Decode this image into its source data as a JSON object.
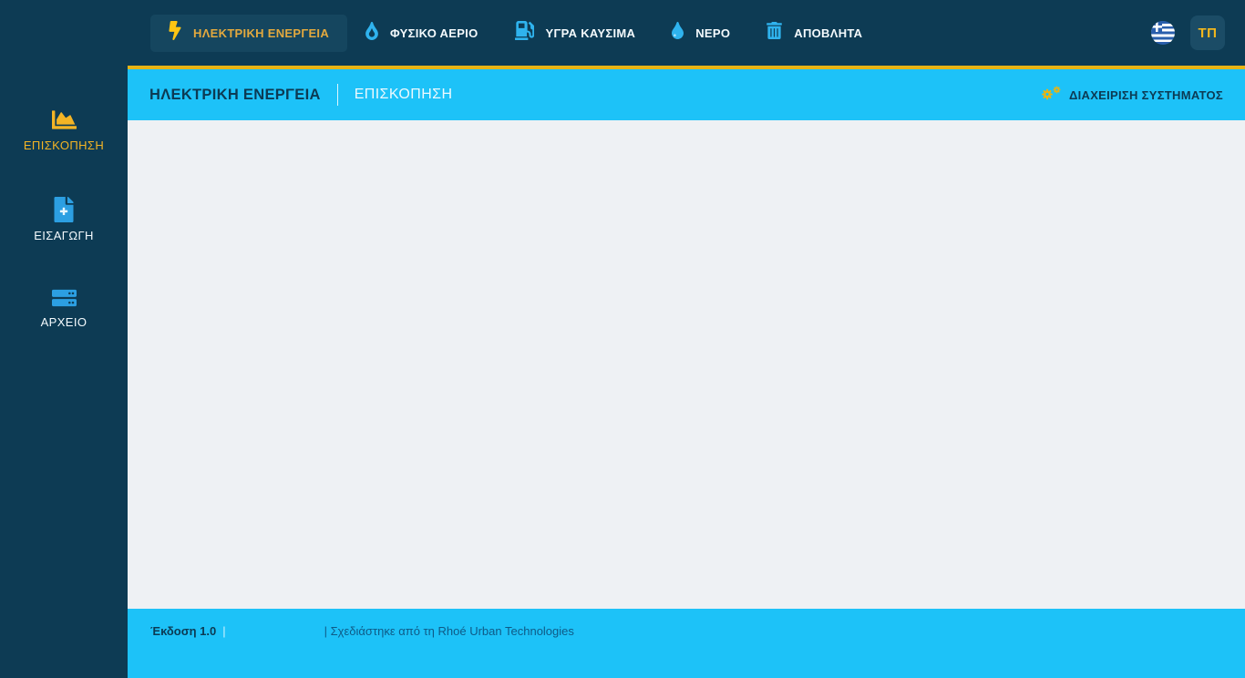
{
  "topnav": {
    "tabs": [
      {
        "label": "ΗΛΕΚΤΡΙΚΗ ΕΝΕΡΓΕΙΑ",
        "icon": "lightning-bolt-icon",
        "active": true
      },
      {
        "label": "ΦΥΣΙΚΟ ΑΕΡΙΟ",
        "icon": "gas-drop-icon",
        "active": false
      },
      {
        "label": "ΥΓΡΑ ΚΑΥΣΙΜΑ",
        "icon": "fuel-pump-icon",
        "active": false
      },
      {
        "label": "ΝΕΡΟ",
        "icon": "water-drop-icon",
        "active": false
      },
      {
        "label": "ΑΠΟΒΛΗΤΑ",
        "icon": "trash-icon",
        "active": false
      }
    ],
    "language_flag": "greek-flag-icon",
    "user_initials": "ΤΠ"
  },
  "sidebar": {
    "items": [
      {
        "label": "ΕΠΙΣΚΟΠΗΣΗ",
        "icon": "area-chart-icon",
        "active": true
      },
      {
        "label": "ΕΙΣΑΓΩΓΗ",
        "icon": "file-plus-icon",
        "active": false
      },
      {
        "label": "ΑΡΧΕΙΟ",
        "icon": "server-icon",
        "active": false
      }
    ]
  },
  "page_header": {
    "title": "ΗΛΕΚΤΡΙΚΗ ΕΝΕΡΓΕΙΑ",
    "breadcrumb": "ΕΠΙΣΚΟΠΗΣΗ",
    "admin_link": "ΔΙΑΧΕΙΡΙΣΗ ΣΥΣΤΗΜΑΤΟΣ",
    "admin_icon": "gears-icon"
  },
  "footer": {
    "version": "Έκδοση 1.0",
    "separator": "|",
    "credit": "| Σχεδιάστηκε από τη Rhoé Urban Technologies"
  },
  "colors": {
    "navy": "#0d3b54",
    "active_tab_bg": "#15465f",
    "accent_gold": "#f3b71d",
    "gold_line": "#e7b414",
    "cyan": "#1dc2f8",
    "content_bg": "#eef1f4",
    "icon_blue": "#2fb3ee"
  }
}
